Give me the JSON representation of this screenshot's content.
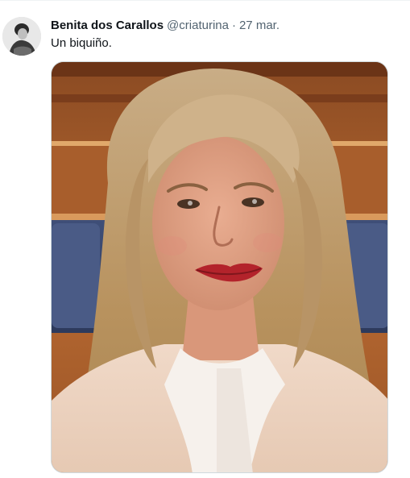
{
  "tweet": {
    "author": {
      "display_name": "Benita dos Carallos",
      "handle": "@criaturina",
      "avatar_icon": "user-avatar"
    },
    "separator": "·",
    "date": "27 mar.",
    "text": "Un biquiño.",
    "media": {
      "kind": "photo",
      "description_icon": "portrait-photo"
    }
  },
  "colors": {
    "name": "#0f1419",
    "secondary": "#536471",
    "border": "#cfd9de"
  }
}
